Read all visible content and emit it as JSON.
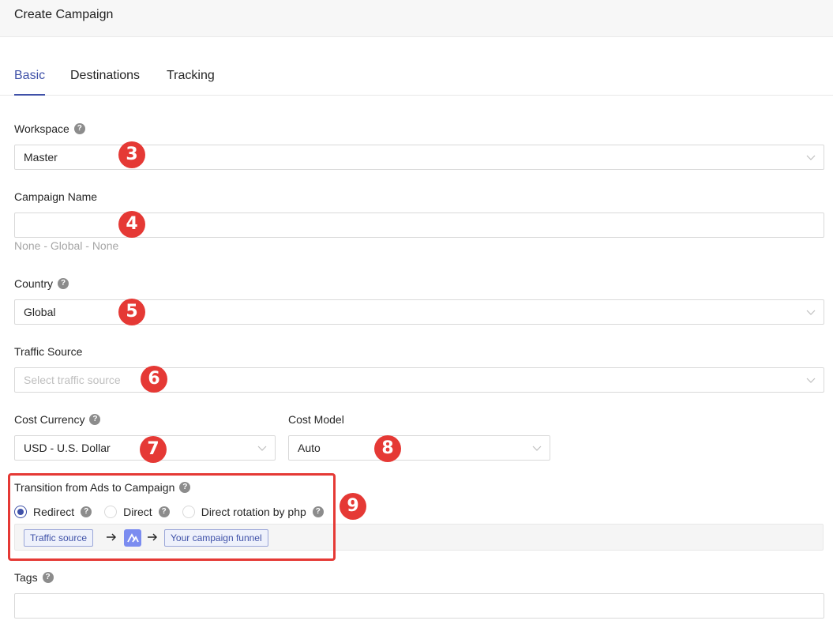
{
  "header": {
    "title": "Create Campaign"
  },
  "tabs": [
    {
      "label": "Basic",
      "active": true
    },
    {
      "label": "Destinations",
      "active": false
    },
    {
      "label": "Tracking",
      "active": false
    }
  ],
  "form": {
    "workspace": {
      "label": "Workspace",
      "value": "Master"
    },
    "campaign_name": {
      "label": "Campaign Name",
      "value": "",
      "hint": "None - Global - None"
    },
    "country": {
      "label": "Country",
      "value": "Global"
    },
    "traffic_source": {
      "label": "Traffic Source",
      "placeholder": "Select traffic source"
    },
    "cost_currency": {
      "label": "Cost Currency",
      "value": "USD - U.S. Dollar"
    },
    "cost_model": {
      "label": "Cost Model",
      "value": "Auto"
    },
    "transition": {
      "label": "Transition from Ads to Campaign",
      "options": [
        {
          "label": "Redirect",
          "checked": true
        },
        {
          "label": "Direct",
          "checked": false
        },
        {
          "label": "Direct rotation by php",
          "checked": false
        }
      ],
      "flow": {
        "source_label": "Traffic source",
        "target_label": "Your campaign funnel"
      }
    },
    "tags": {
      "label": "Tags",
      "value": ""
    }
  },
  "annotations": {
    "badge_3": "3",
    "badge_4": "4",
    "badge_5": "5",
    "badge_6": "6",
    "badge_7": "7",
    "badge_8": "8",
    "badge_9": "9",
    "color": "#e53935"
  },
  "theme": {
    "accent": "#3f51a8"
  },
  "icons": {
    "help": "question-circle-icon",
    "chevron": "chevron-down-icon",
    "arrow": "arrow-right-icon",
    "logo": "app-logo-icon"
  }
}
